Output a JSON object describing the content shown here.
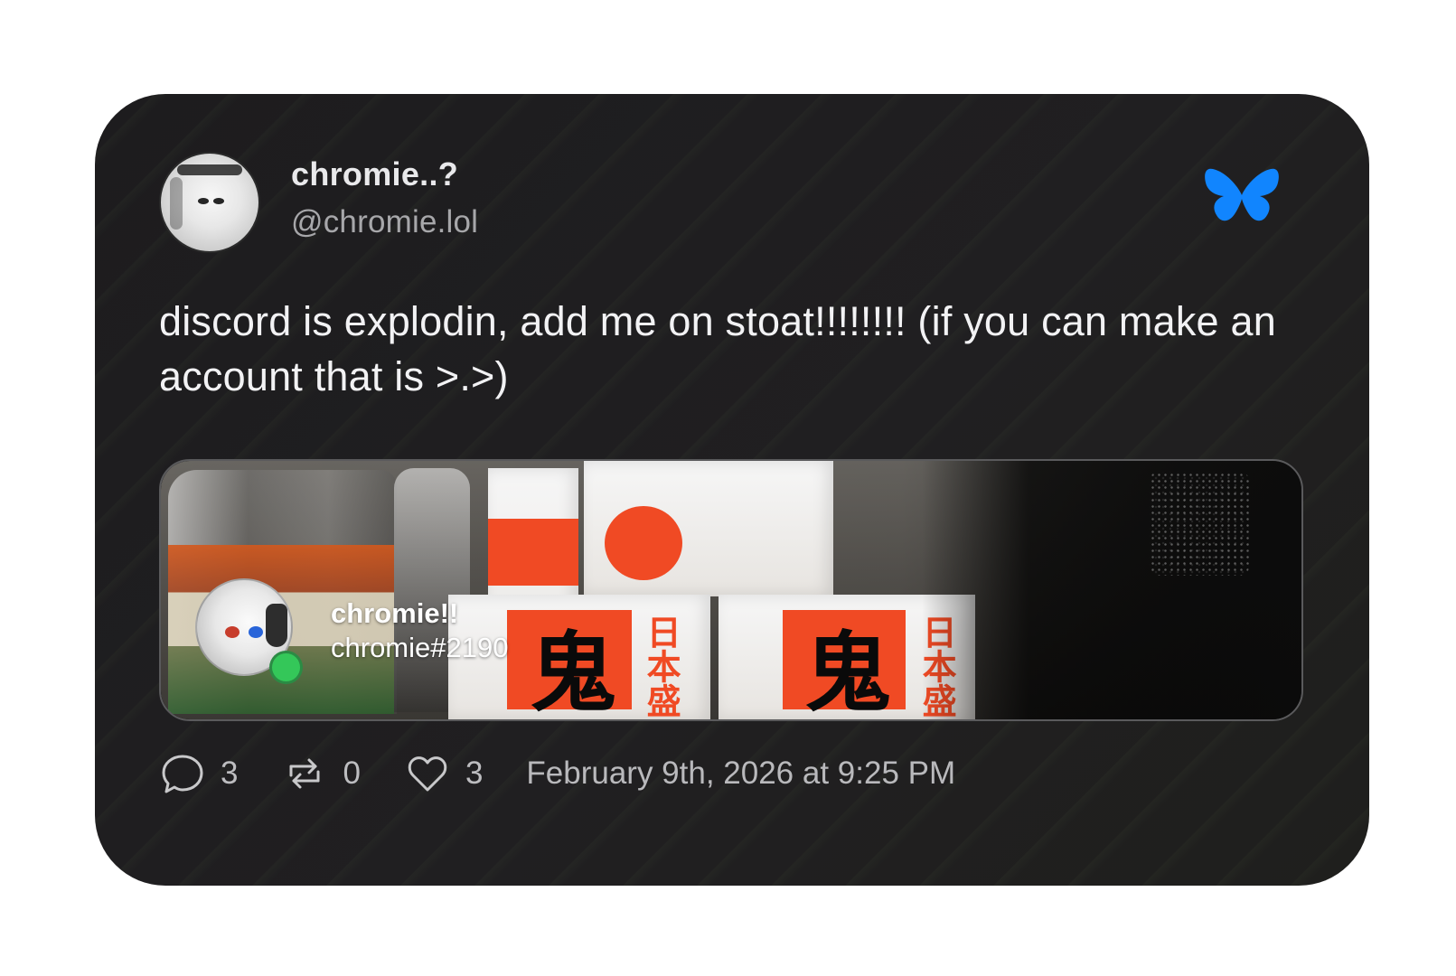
{
  "author": {
    "display_name": "chromie..?",
    "handle": "@chromie.lol"
  },
  "brand": {
    "icon": "butterfly-icon",
    "color": "#1185fe"
  },
  "post": {
    "text": "discord is explodin, add me on stoat!!!!!!!! (if you can make an account that is >.>)"
  },
  "embed": {
    "name": "chromie!!",
    "tag": "chromie#2190",
    "status_color": "#34c759",
    "images": {
      "kanji_main": "鬼",
      "kanji_side": "日本盛"
    }
  },
  "stats": {
    "replies": "3",
    "reposts": "0",
    "likes": "3",
    "date": "February 9th, 2026 at 9:25 PM"
  },
  "icons": {
    "reply": "reply-icon",
    "repost": "repost-icon",
    "like": "heart-icon"
  }
}
